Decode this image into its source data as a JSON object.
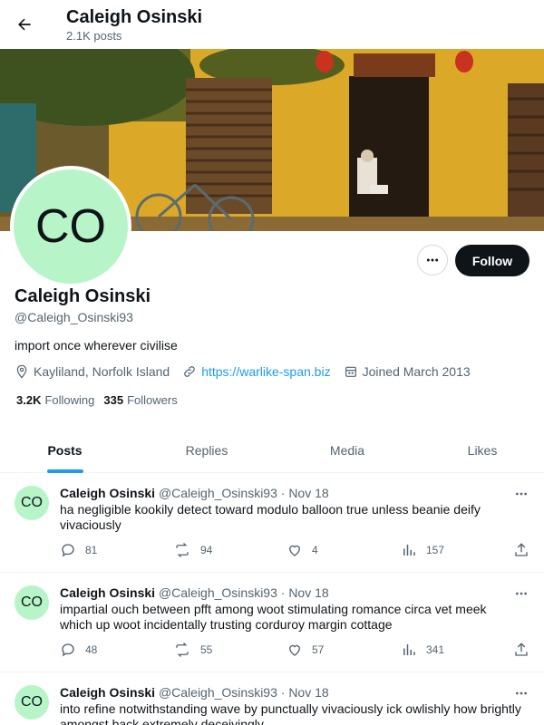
{
  "header": {
    "title": "Caleigh Osinski",
    "post_count": "2.1K posts"
  },
  "profile": {
    "avatar_initials": "CO",
    "name": "Caleigh Osinski",
    "handle": "@Caleigh_Osinski93",
    "bio": "import once wherever civilise",
    "location": "Kayliland, Norfolk Island",
    "website": "https://warlike-span.biz",
    "joined": "Joined March 2013",
    "following_count": "3.2K",
    "following_label": "Following",
    "followers_count": "335",
    "followers_label": "Followers",
    "follow_label": "Follow"
  },
  "tabs": [
    {
      "label": "Posts",
      "active": true
    },
    {
      "label": "Replies",
      "active": false
    },
    {
      "label": "Media",
      "active": false
    },
    {
      "label": "Likes",
      "active": false
    }
  ],
  "posts": [
    {
      "initials": "CO",
      "name": "Caleigh Osinski",
      "handle_date": "@Caleigh_Osinski93 · Nov 18",
      "text": "ha negligible kookily detect toward modulo balloon true unless beanie deify vivaciously",
      "replies": "81",
      "reposts": "94",
      "likes": "4",
      "views": "157"
    },
    {
      "initials": "CO",
      "name": "Caleigh Osinski",
      "handle_date": "@Caleigh_Osinski93 · Nov 18",
      "text": "impartial ouch between pfft among woot stimulating romance circa vet meek which up woot incidentally trusting corduroy margin cottage",
      "replies": "48",
      "reposts": "55",
      "likes": "57",
      "views": "341"
    },
    {
      "initials": "CO",
      "name": "Caleigh Osinski",
      "handle_date": "@Caleigh_Osinski93 · Nov 18",
      "text": "into refine notwithstanding wave by punctually vivaciously ick owlishly how brightly amongst back extremely deceivingly",
      "replies": "",
      "reposts": "",
      "likes": "",
      "views": ""
    }
  ],
  "colors": {
    "accent": "#1d9bf0",
    "avatar_bg": "#b7f4c8",
    "text": "#0f1419",
    "muted": "#536471"
  }
}
